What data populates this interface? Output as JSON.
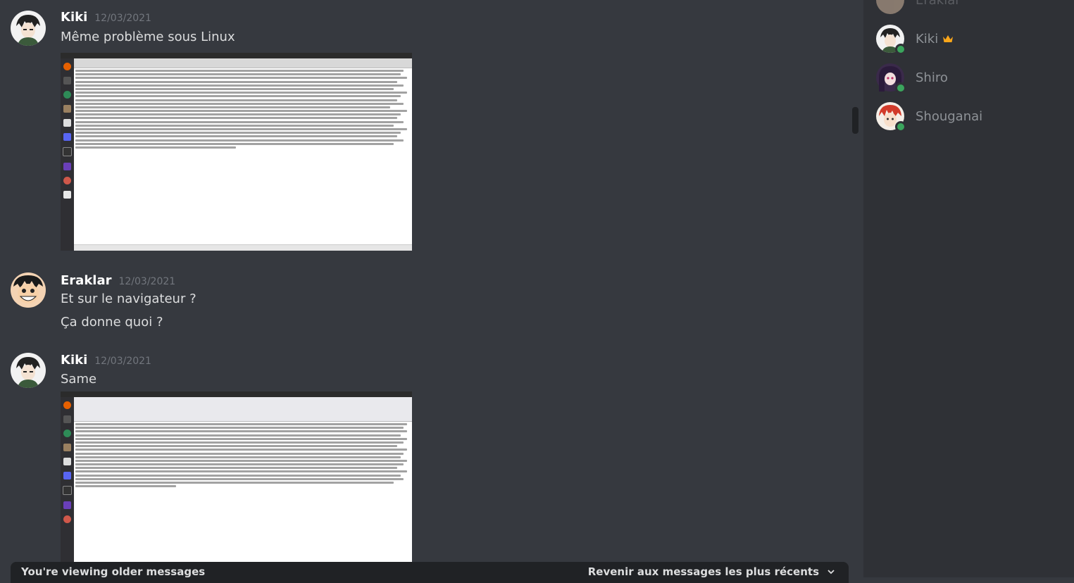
{
  "messages": [
    {
      "author": "Kiki",
      "time": "12/03/2021",
      "lines": [
        "Même problème sous Linux"
      ]
    },
    {
      "author": "Eraklar",
      "time": "12/03/2021",
      "lines": [
        "Et sur le navigateur ?",
        "Ça donne quoi ?"
      ]
    },
    {
      "author": "Kiki",
      "time": "12/03/2021",
      "lines": [
        "Same"
      ]
    }
  ],
  "older_bar": {
    "notice": "You're viewing older messages",
    "jump_label": "Revenir aux messages les plus récents"
  },
  "members": [
    {
      "name": "Eraklar"
    },
    {
      "name": "Kiki",
      "owner_icon": "crown-icon"
    },
    {
      "name": "Shiro"
    },
    {
      "name": "Shouganai"
    }
  ],
  "colors": {
    "background": "#36393f",
    "sidebar": "#2f3136",
    "online": "#3ba55d",
    "crown": "#faa61a"
  }
}
